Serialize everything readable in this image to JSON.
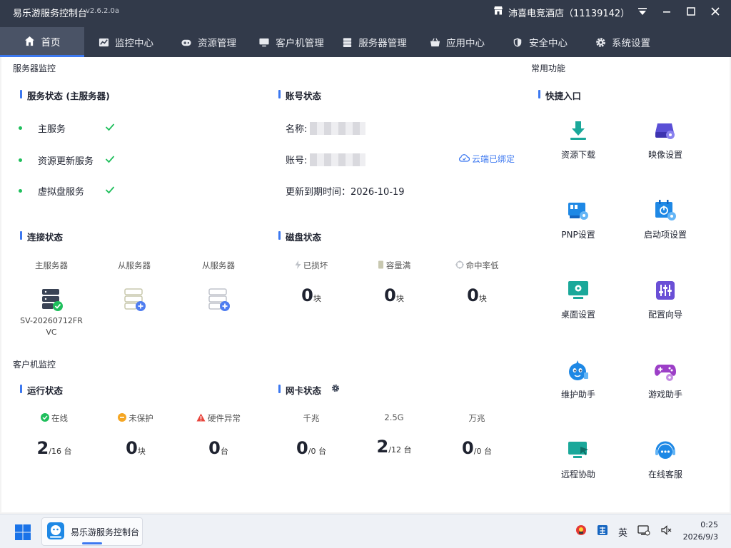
{
  "app": {
    "title": "易乐游服务控制台",
    "version": "v2.6.2.0a",
    "venue": "沛喜电竞酒店（11139142）"
  },
  "nav": [
    "首页",
    "监控中心",
    "资源管理",
    "客户机管理",
    "服务器管理",
    "应用中心",
    "安全中心",
    "系统设置"
  ],
  "server_monitor": {
    "title": "服务器监控",
    "service_status": {
      "title": "服务状态 (主服务器)",
      "items": [
        "主服务",
        "资源更新服务",
        "虚拟盘服务"
      ]
    },
    "account": {
      "title": "账号状态",
      "name_label": "名称:",
      "account_label": "账号:",
      "expiry": "更新到期时间：2026-10-19",
      "cloud_bound": "云端已绑定"
    },
    "connection": {
      "title": "连接状态",
      "main": "主服务器",
      "slave1": "从服务器",
      "slave2": "从服务器",
      "main_name": "SV-20260712FRVC"
    },
    "disk": {
      "title": "磁盘状态",
      "damaged_label": "已损坏",
      "full_label": "容量满",
      "low_hit_label": "命中率低",
      "damaged": "0",
      "full": "0",
      "low_hit": "0",
      "unit": "块"
    }
  },
  "client_monitor": {
    "title": "客户机监控",
    "run": {
      "title": "运行状态",
      "online_label": "在线",
      "unprotected_label": "未保护",
      "hw_label": "硬件异常",
      "online": "2",
      "online_total": "/16 台",
      "unprotected": "0",
      "unprotected_unit": "块",
      "hw": "0",
      "hw_unit": "台"
    },
    "nic": {
      "title": "网卡状态",
      "gigabit_label": "千兆",
      "g25_label": "2.5G",
      "g10_label": "万兆",
      "gigabit": "0",
      "gigabit_total": "/0 台",
      "g25": "2",
      "g25_total": "/12 台",
      "g10": "0",
      "g10_total": "/0 台"
    }
  },
  "common": {
    "title": "常用功能",
    "quick_title": "快捷入口",
    "items": [
      "资源下载",
      "映像设置",
      "PNP设置",
      "启动项设置",
      "桌面设置",
      "配置向导",
      "维护助手",
      "游戏助手",
      "远程协助",
      "在线客服"
    ]
  },
  "taskbar": {
    "app": "易乐游服务控制台",
    "ime": "英",
    "time": "0:25",
    "date": "2026/9/3"
  },
  "colors": {
    "topbar": "#323a4a",
    "accent": "#3c78f0",
    "ok": "#1fbf5c",
    "teal": "#1aa89a"
  }
}
